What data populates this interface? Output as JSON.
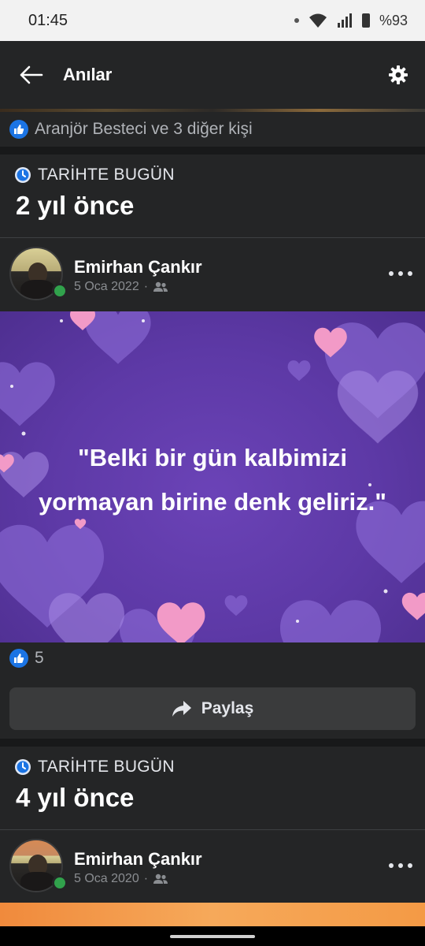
{
  "status_bar": {
    "time": "01:45",
    "battery": "%93"
  },
  "header": {
    "title": "Anılar"
  },
  "top_post": {
    "likes_text": "Aranjör Besteci ve 3 diğer kişi"
  },
  "memories": [
    {
      "label": "TARİHTE BUGÜN",
      "ago": "2 yıl önce",
      "author": "Emirhan Çankır",
      "date": "5 Oca 2022",
      "quote": "\"Belki bir gün kalbimizi\nyormayan birine denk geliriz.\"",
      "like_count": "5",
      "share_label": "Paylaş"
    },
    {
      "label": "TARİHTE BUGÜN",
      "ago": "4 yıl önce",
      "author": "Emirhan Çankır",
      "date": "5 Oca 2020"
    }
  ],
  "icons": {
    "back": "arrow-left-icon",
    "settings": "gear-icon",
    "like": "thumbs-up-icon",
    "clock": "clock-icon",
    "audience": "friends-icon",
    "share": "share-arrow-icon",
    "more": "ellipsis-icon"
  },
  "colors": {
    "accent": "#1b74e4",
    "online": "#31a24c",
    "image_bg": "#5d39a6"
  }
}
